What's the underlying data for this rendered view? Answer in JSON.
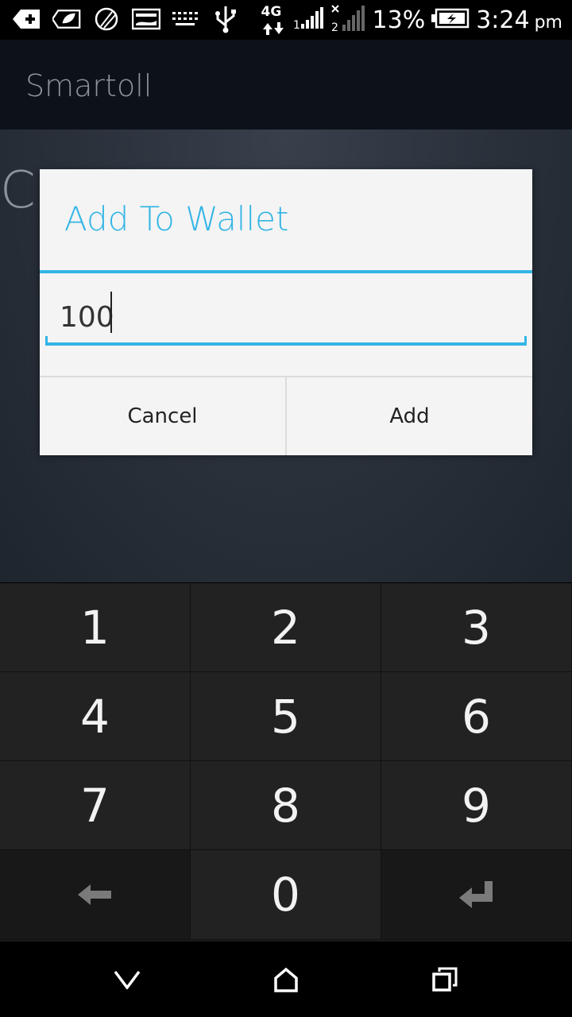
{
  "status_bar": {
    "icons": [
      "add-notification-icon",
      "leaf-icon",
      "cricket-ball-icon",
      "gallery-icon",
      "keyboard-icon",
      "usb-icon",
      "network-4g-icon",
      "signal-sim1-icon",
      "signal-sim2-icon",
      "battery-charging-icon"
    ],
    "network_label": "4G",
    "battery_percent": "13%",
    "time": "3:24",
    "time_suffix": "pm"
  },
  "app_bar": {
    "title": "Smartoll"
  },
  "background": {
    "partial_letter": "C"
  },
  "dialog": {
    "title": "Add To Wallet",
    "input_value": "100",
    "cancel_label": "Cancel",
    "add_label": "Add"
  },
  "keypad": {
    "keys": [
      "1",
      "2",
      "3",
      "4",
      "5",
      "6",
      "7",
      "8",
      "9",
      "backspace-icon",
      "0",
      "enter-icon"
    ],
    "digit_labels": {
      "k1": "1",
      "k2": "2",
      "k3": "3",
      "k4": "4",
      "k5": "5",
      "k6": "6",
      "k7": "7",
      "k8": "8",
      "k9": "9",
      "k0": "0"
    }
  },
  "nav_bar": {
    "icons": [
      "back-icon",
      "home-icon",
      "recents-icon"
    ]
  },
  "colors": {
    "accent": "#33b5e5",
    "app_title": "#8d939b",
    "keypad_bg": "#222222"
  }
}
